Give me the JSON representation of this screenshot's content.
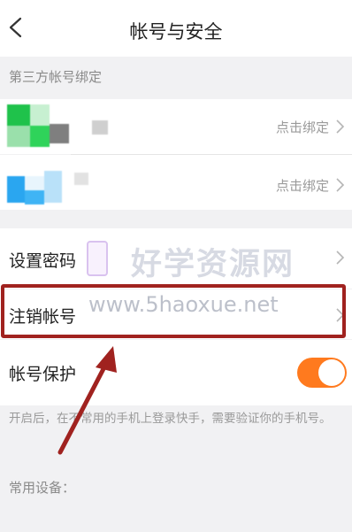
{
  "header": {
    "title": "帐号与安全"
  },
  "third_party": {
    "section_label": "第三方帐号绑定",
    "items": [
      {
        "name": "wechat-account",
        "action": "点击绑定"
      },
      {
        "name": "qq-account",
        "action": "点击绑定"
      }
    ]
  },
  "settings": {
    "set_password": "设置密码",
    "cancel_account": "注销帐号",
    "account_protection": "帐号保护",
    "account_protection_on": true,
    "protection_desc": "开启后，在不常用的手机上登录快手，需要验证你的手机号。",
    "common_devices_label": "常用设备："
  },
  "watermark": {
    "name": "好学资源网",
    "url": "www.5haoxue.net"
  },
  "colors": {
    "accent": "#ff7a1e",
    "highlight": "#a0221f",
    "background": "#f1f1f3"
  }
}
